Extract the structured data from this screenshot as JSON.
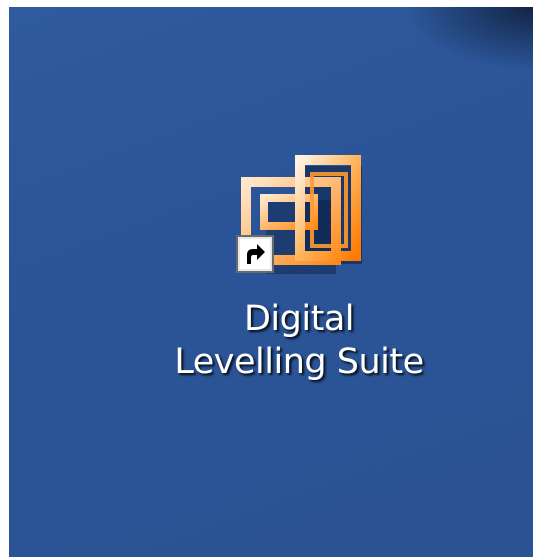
{
  "desktop": {
    "background_color": "#2b5595",
    "shortcut": {
      "icon": "digital-levelling-suite-app-icon",
      "overlay_icon": "shortcut-arrow-icon",
      "label_lines": [
        "Digital",
        "Levelling Suite"
      ],
      "accent_color": "#ff8a1a"
    }
  }
}
